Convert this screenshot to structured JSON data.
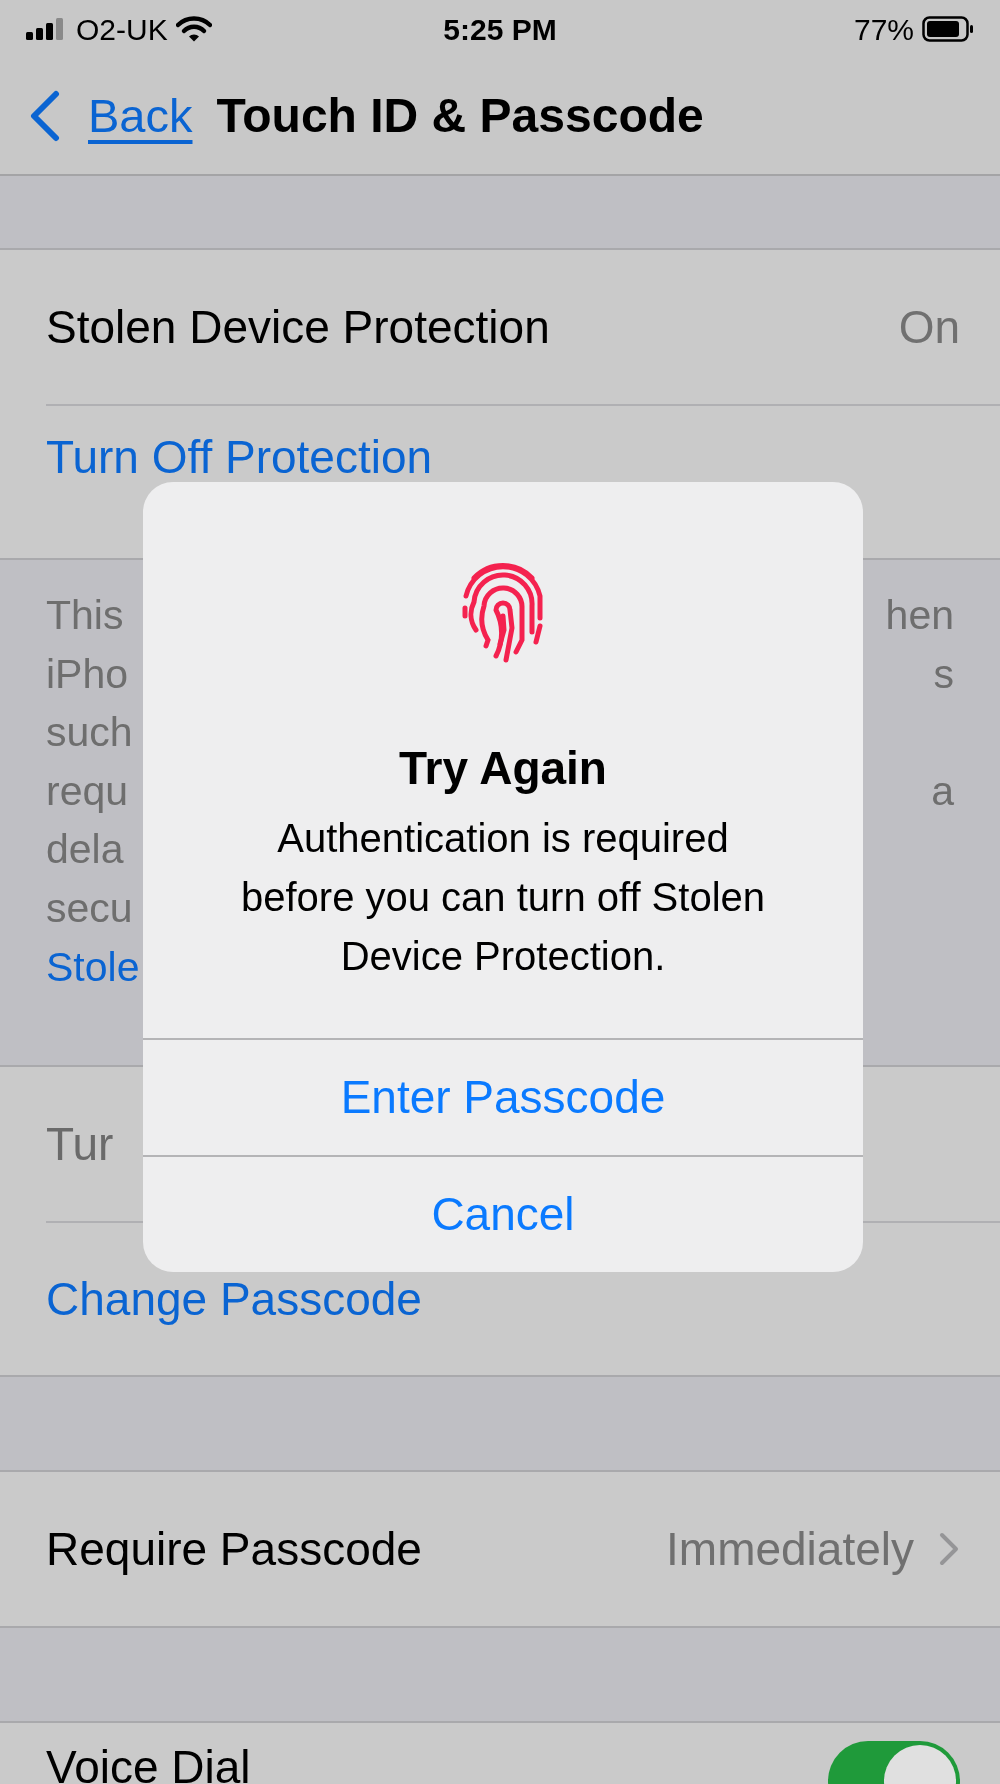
{
  "status_bar": {
    "carrier": "O2-UK",
    "time": "5:25 PM",
    "battery": "77%"
  },
  "nav": {
    "back": "Back",
    "title": "Touch ID & Passcode"
  },
  "groups": [
    {
      "rows": [
        {
          "kind": "value",
          "label": "Stolen Device Protection",
          "value": "On"
        },
        {
          "kind": "link",
          "label": "Turn Off Protection"
        }
      ],
      "footer": [
        {
          "left": "This",
          "right": "hen"
        },
        {
          "left": "iPho",
          "right": "s"
        },
        {
          "left": "such"
        },
        {
          "left": "requ",
          "right": "a"
        },
        {
          "left": "dela"
        },
        {
          "left": "secu"
        },
        {
          "left": "Stole",
          "kind": "link"
        }
      ]
    },
    {
      "rows": [
        {
          "kind": "dimmed",
          "label": "Tur"
        },
        {
          "kind": "link",
          "label": "Change Passcode"
        }
      ]
    },
    {
      "rows": [
        {
          "kind": "chevron",
          "label": "Require Passcode",
          "value": "Immediately"
        }
      ]
    },
    {
      "rows": [
        {
          "kind": "toggle",
          "label": "Voice Dial",
          "on": true
        }
      ]
    }
  ],
  "alert": {
    "title": "Try Again",
    "message": "Authentication is required before you can turn off Stolen Device Protection.",
    "buttons": [
      "Enter Passcode",
      "Cancel"
    ]
  }
}
